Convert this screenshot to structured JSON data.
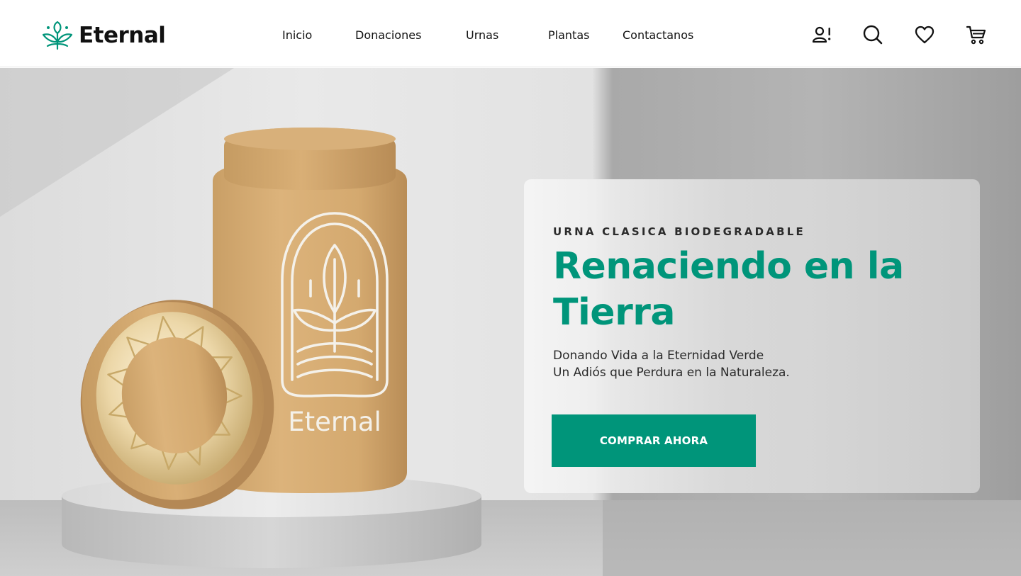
{
  "brand": {
    "name": "Eternal",
    "logo_icon": "leaf-sprout-icon",
    "accent_color": "#00957a"
  },
  "nav": {
    "items": [
      {
        "label": "Inicio"
      },
      {
        "label": "Donaciones"
      },
      {
        "label": "Urnas"
      },
      {
        "label": "Plantas"
      },
      {
        "label": "Contactanos"
      }
    ]
  },
  "header_icons": [
    "user-alert-icon",
    "search-icon",
    "heart-icon",
    "cart-icon"
  ],
  "hero": {
    "eyebrow": "URNA CLASICA BIODEGRADABLE",
    "title": "Renaciendo en la Tierra",
    "subtitle_line1": "Donando Vida a la Eternidad Verde",
    "subtitle_line2": "Un Adiós que Perdura en la Naturaleza.",
    "cta_label": "COMPRAR AHORA",
    "product_label": "Eternal"
  }
}
